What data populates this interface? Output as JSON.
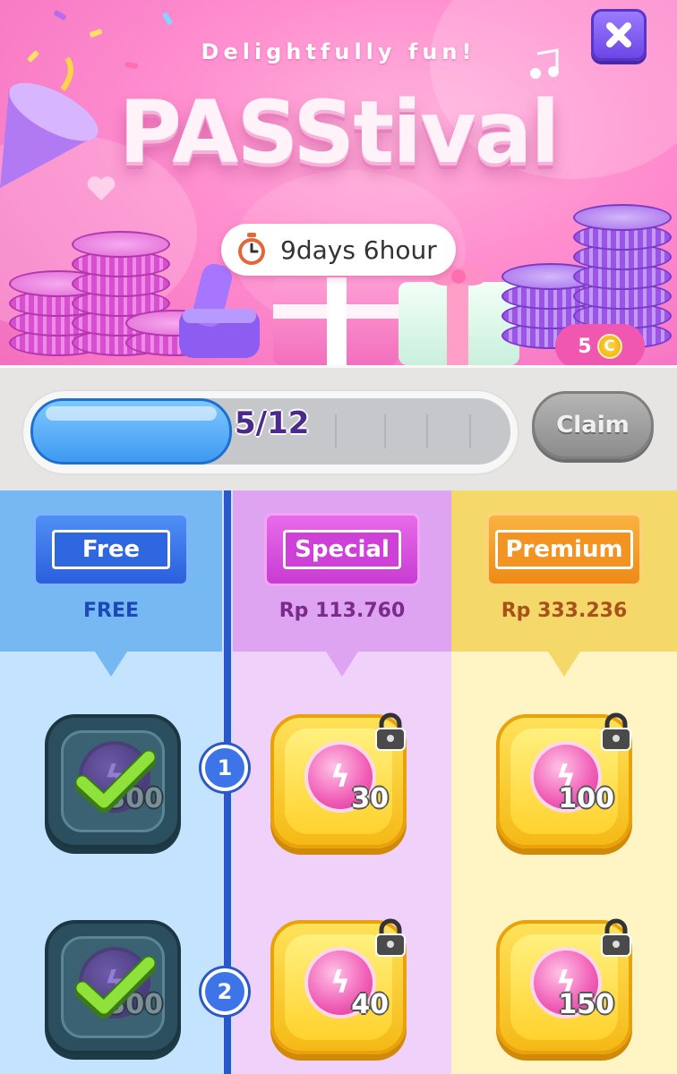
{
  "banner": {
    "subtitle": "Delightfully fun!",
    "title": "PASStival",
    "timer": "9days 6hour",
    "close_icon": "close-icon"
  },
  "progress": {
    "label": "5/12",
    "value": 5,
    "max": 12,
    "claim_label": "Claim",
    "coin_reward": "5",
    "coin_symbol": "C"
  },
  "tiers": [
    {
      "name": "Free",
      "price": "FREE",
      "color": "#2f67e0"
    },
    {
      "name": "Special",
      "price": "Rp 113.760",
      "color": "#cf40d9"
    },
    {
      "name": "Premium",
      "price": "Rp 333.236",
      "color": "#f29322"
    }
  ],
  "levels": [
    {
      "number": "1",
      "free": {
        "amount": "300",
        "claimed": true
      },
      "special": {
        "amount": "30",
        "locked": true
      },
      "premium": {
        "amount": "100",
        "locked": true
      }
    },
    {
      "number": "2",
      "free": {
        "amount": "300",
        "claimed": true
      },
      "special": {
        "amount": "40",
        "locked": true
      },
      "premium": {
        "amount": "150",
        "locked": true
      }
    }
  ]
}
